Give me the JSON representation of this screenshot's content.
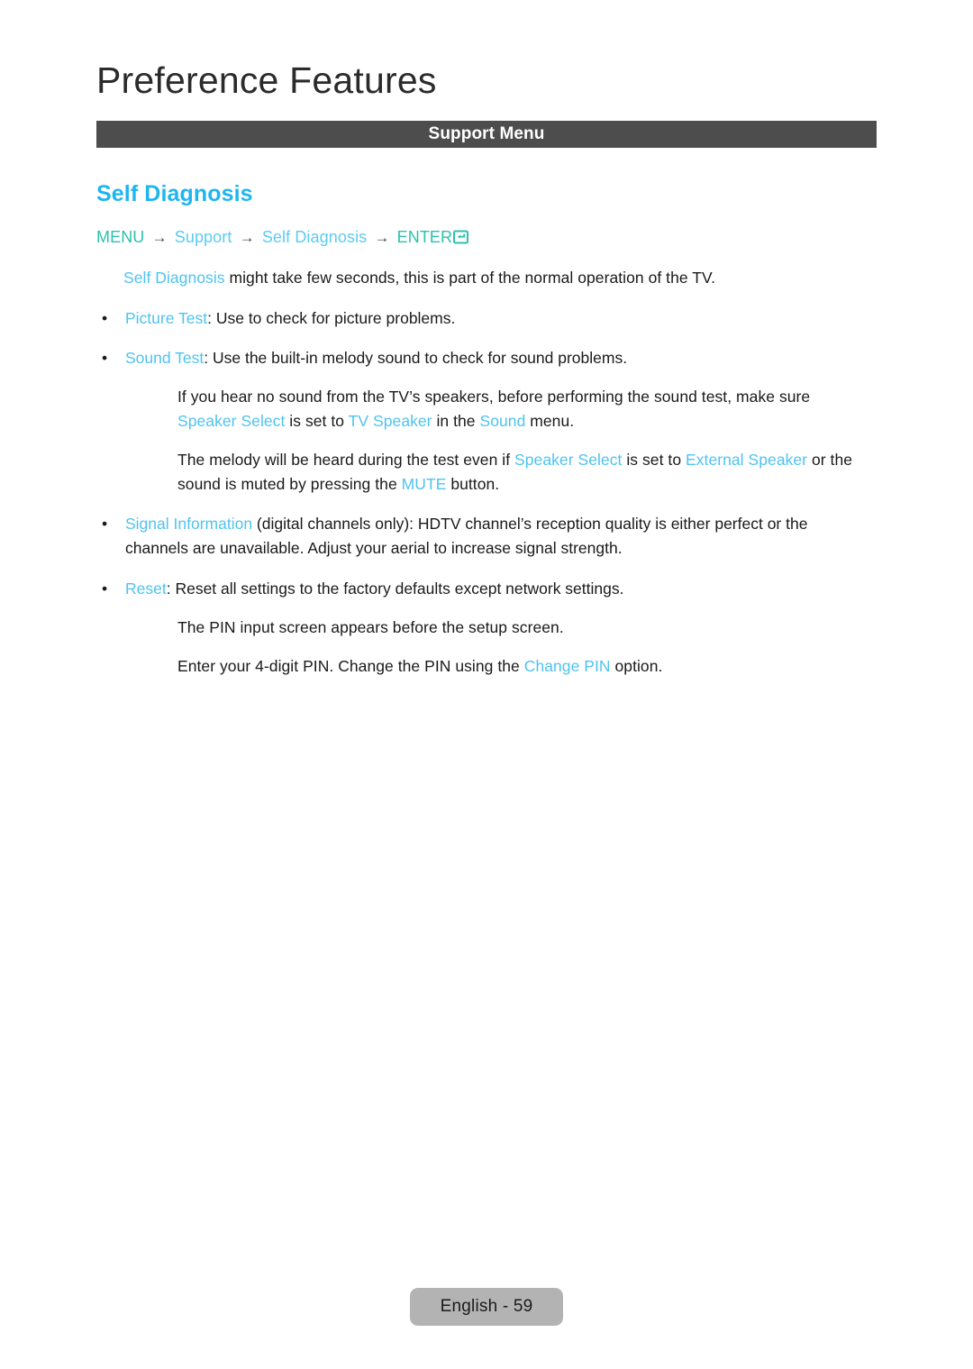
{
  "header": {
    "chapter_title": "Preference Features",
    "section_bar_label": "Support Menu"
  },
  "feature": {
    "heading": "Self Diagnosis",
    "breadcrumb": {
      "menu": "MENU",
      "arrow": "→",
      "support": "Support",
      "self_diagnosis": "Self Diagnosis",
      "enter": "ENTER",
      "enter_icon": "enter-key-icon"
    },
    "intro": {
      "term": "Self Diagnosis",
      "rest": " might take few seconds, this is part of the normal operation of the TV."
    },
    "bullets": [
      {
        "dot": "•",
        "term": "Picture Test",
        "rest": ": Use to check for picture problems."
      },
      {
        "dot": "•",
        "term": "Sound Test",
        "rest": ": Use the built-in melody sound to check for sound problems."
      },
      {
        "dot": "•",
        "term": "Signal Information",
        "rest": " (digital channels only): HDTV channel’s reception quality is either perfect or the channels are unavailable. Adjust your aerial to increase signal strength."
      },
      {
        "dot": "•",
        "term": "Reset",
        "rest": ": Reset all settings to the factory defaults except network settings."
      }
    ],
    "sound_test_note_1": {
      "seg_1": "If you hear no sound from the TV’s speakers, before performing the sound test, make sure ",
      "hl_1": "Speaker Select",
      "seg_2": " is set to ",
      "hl_2": "TV Speaker",
      "seg_3": " in the ",
      "hl_3": "Sound",
      "seg_4": " menu."
    },
    "sound_test_note_2": {
      "seg_1": "The melody will be heard during the test even if ",
      "hl_1": "Speaker Select",
      "seg_2": " is set to ",
      "hl_2": "External Speaker",
      "seg_3": " or the sound is muted by pressing the ",
      "hl_3": "MUTE",
      "seg_4": " button."
    },
    "reset_note_1": "The PIN input screen appears before the setup screen.",
    "reset_note_2": {
      "seg_1": "Enter your 4-digit PIN. Change the PIN using the ",
      "hl_1": "Change PIN",
      "seg_2": " option."
    }
  },
  "footer": {
    "page_label": "English - 59"
  },
  "colors": {
    "heading_blue": "#1fb6ef",
    "highlight_cyan": "#4fc3f0",
    "breadcrumb_teal": "#2bc2ae",
    "bar_gray": "#4d4d4d",
    "footer_pill_gray": "#b3b3b3",
    "body_text": "#1a1a1a"
  }
}
